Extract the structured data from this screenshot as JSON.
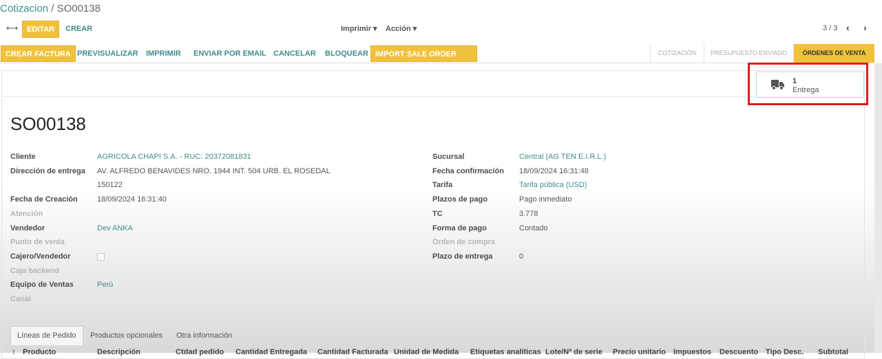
{
  "breadcrumb": {
    "parent": "Cotizacion",
    "current": "SO00138"
  },
  "control": {
    "edit": "Editar",
    "create": "Crear",
    "print": "Imprimir",
    "action": "Acción",
    "pager": "3 / 3"
  },
  "actions": [
    "Crear Factura",
    "Previsualizar",
    "Imprimir",
    "Enviar por Email",
    "Cancelar",
    "Bloquear",
    "Import Sale Order Lines"
  ],
  "stages": [
    "Cotización",
    "Presupuesto enviado",
    "Órdenes de venta"
  ],
  "stat_button": {
    "count": "1",
    "label": "Entrega",
    "icon": "truck-icon"
  },
  "title": "SO00138",
  "left_fields": [
    {
      "label": "Cliente",
      "value": "AGRICOLA CHAPI S.A. - RUC: 20372081831",
      "link": true
    },
    {
      "label": "Dirección de entrega",
      "value": "AV. ALFREDO BENAVIDES NRO. 1944 INT. 504 URB. EL ROSEDAL"
    },
    {
      "label": "",
      "value": "150122"
    },
    {
      "label": "Fecha de Creación",
      "value": "18/09/2024 16:31:40"
    },
    {
      "label": "Atención",
      "value": "",
      "dim": true
    },
    {
      "label": "Vendedor",
      "value": "Dev ANKA",
      "link": true
    },
    {
      "label": "Punto de venta",
      "value": "",
      "dim": true
    },
    {
      "label": "Cajero/Vendedor",
      "value": "",
      "checkbox": true
    },
    {
      "label": "Caja backend",
      "value": "",
      "dim": true
    },
    {
      "label": "Equipo de Ventas",
      "value": "Perú",
      "link": true
    },
    {
      "label": "Canal",
      "value": "",
      "dim": true
    }
  ],
  "right_fields": [
    {
      "label": "Sucursal",
      "value": "Central (AG TEN E.I.R.L.)",
      "link": true
    },
    {
      "label": "Fecha confirmación",
      "value": "18/09/2024 16:31:48"
    },
    {
      "label": "Tarifa",
      "value": "Tarifa pública (USD)",
      "link": true
    },
    {
      "label": "Plazos de pago",
      "value": "Pago inmediato"
    },
    {
      "label": "TC",
      "value": "3.778"
    },
    {
      "label": "Forma de pago",
      "value": "Contado"
    },
    {
      "label": "Orden de compra",
      "value": "",
      "dim": true
    },
    {
      "label": "Plazo de entrega",
      "value": "0"
    }
  ],
  "tabs": [
    "Líneas de Pedido",
    "Productos opcionales",
    "Otra información"
  ],
  "columns": [
    "Producto",
    "Descripción",
    "Ctdad pedido",
    "Cantidad Entregada",
    "Cantidad Facturada",
    "Unidad de Medida",
    "Etiquetas analíticas",
    "Lote/Nº de serie",
    "Precio unitario",
    "Impuestos",
    "Descuento",
    "Tipo Desc.",
    "Subtotal"
  ],
  "colors": {
    "accent": "#f0c23b",
    "link": "#3e8c8a",
    "highlight": "#e01b1b"
  }
}
